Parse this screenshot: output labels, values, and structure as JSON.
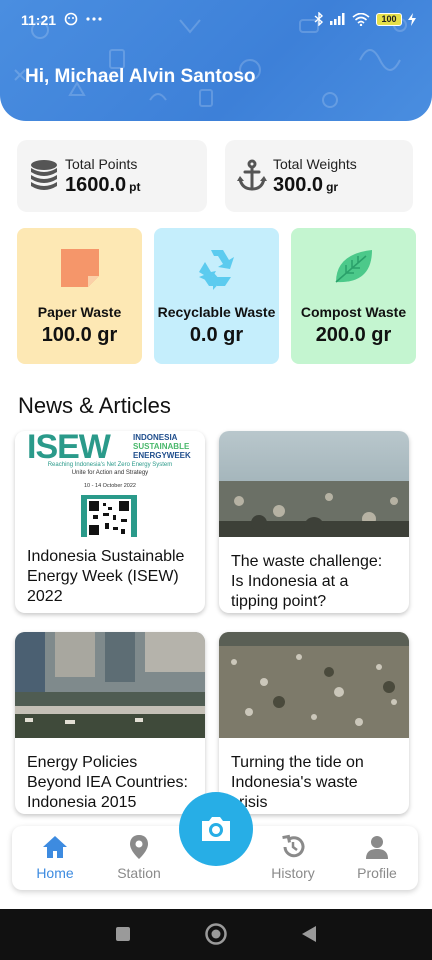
{
  "status_bar": {
    "time": "11:21",
    "battery": "100"
  },
  "header": {
    "greeting": "Hi, Michael Alvin Santoso"
  },
  "stats": [
    {
      "label": "Total Points",
      "value": "1600.0",
      "unit": "pt",
      "icon": "coins-stack-icon"
    },
    {
      "label": "Total Weights",
      "value": "300.0",
      "unit": "gr",
      "icon": "anchor-icon"
    }
  ],
  "waste": [
    {
      "label": "Paper Waste",
      "value": "100.0 gr",
      "bg": "#fde8b4",
      "icon": "paper-icon"
    },
    {
      "label": "Recyclable Waste",
      "value": "0.0 gr",
      "bg": "#c5eefc",
      "icon": "recycle-icon"
    },
    {
      "label": "Compost Waste",
      "value": "200.0 gr",
      "bg": "#c4f5d0",
      "icon": "leaf-icon"
    }
  ],
  "news_section": {
    "title": "News & Articles"
  },
  "news": [
    {
      "title": "Indonesia Sustainable Energy Week (ISEW) 2022",
      "poster": {
        "big": "ISEW",
        "side1": "INDONESIA",
        "side2": "SUSTAINABLE",
        "side3": "ENERGYWEEK",
        "line1": "Reaching Indonesia's Net Zero Energy System",
        "line2": "Unite for Action and Strategy",
        "date": "10 - 14 October 2022"
      }
    },
    {
      "title": "The waste challenge: Is Indonesia at a tipping point?"
    },
    {
      "title": "Energy Policies Beyond IEA Countries: Indonesia 2015"
    },
    {
      "title": "Turning the tide on Indonesia's waste crisis"
    }
  ],
  "nav": {
    "home": "Home",
    "station": "Station",
    "history": "History",
    "profile": "Profile",
    "active": "home"
  },
  "colors": {
    "header": "#3d80d8",
    "accent": "#3d8be0",
    "camera": "#27aee6"
  }
}
